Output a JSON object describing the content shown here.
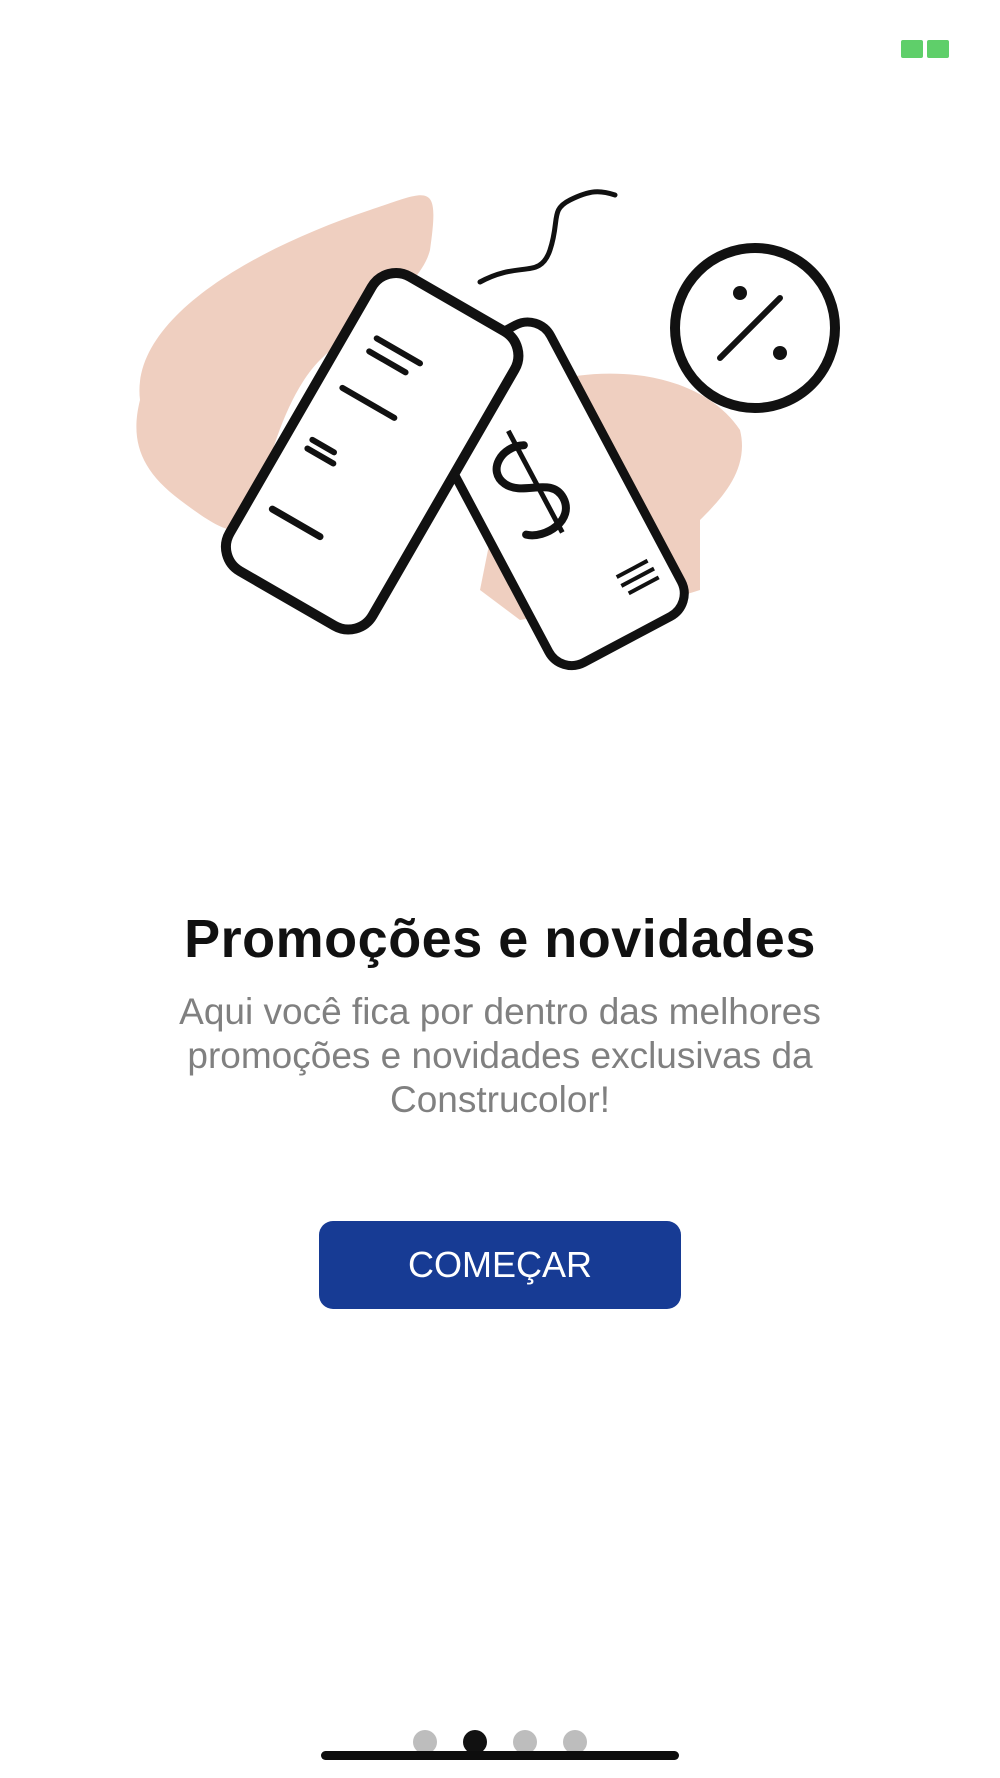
{
  "status": {
    "icon": "battery-icon",
    "color": "#5fcf6a"
  },
  "onboarding": {
    "illustration_icon": "discount-price-tags-icon",
    "title": "Promoções e novidades",
    "description": "Aqui você fica por dentro das melhores promoções e novidades exclusivas da Construcolor!",
    "button_label": "COMEÇAR",
    "button_color": "#173b94",
    "page_indicator": {
      "total": 4,
      "active_index": 1
    }
  }
}
